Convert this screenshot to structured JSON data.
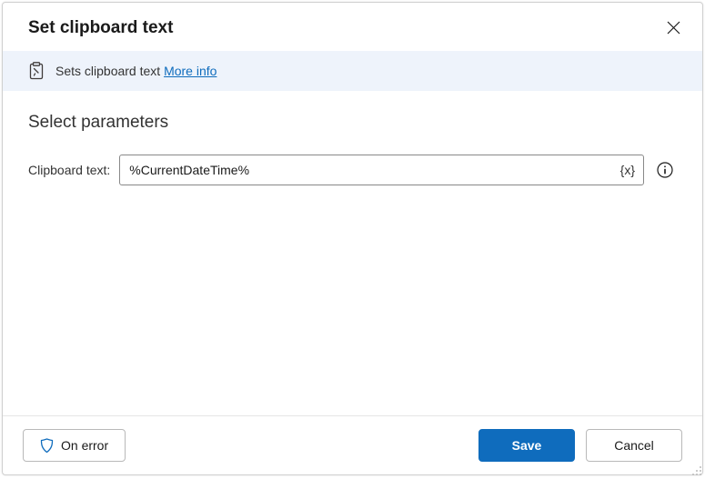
{
  "header": {
    "title": "Set clipboard text"
  },
  "info": {
    "text": "Sets clipboard text",
    "link_label": "More info"
  },
  "section": {
    "title": "Select parameters"
  },
  "params": {
    "clipboard_text": {
      "label": "Clipboard text:",
      "value": "%CurrentDateTime%",
      "var_button": "{x}"
    }
  },
  "footer": {
    "on_error": "On error",
    "save": "Save",
    "cancel": "Cancel"
  }
}
